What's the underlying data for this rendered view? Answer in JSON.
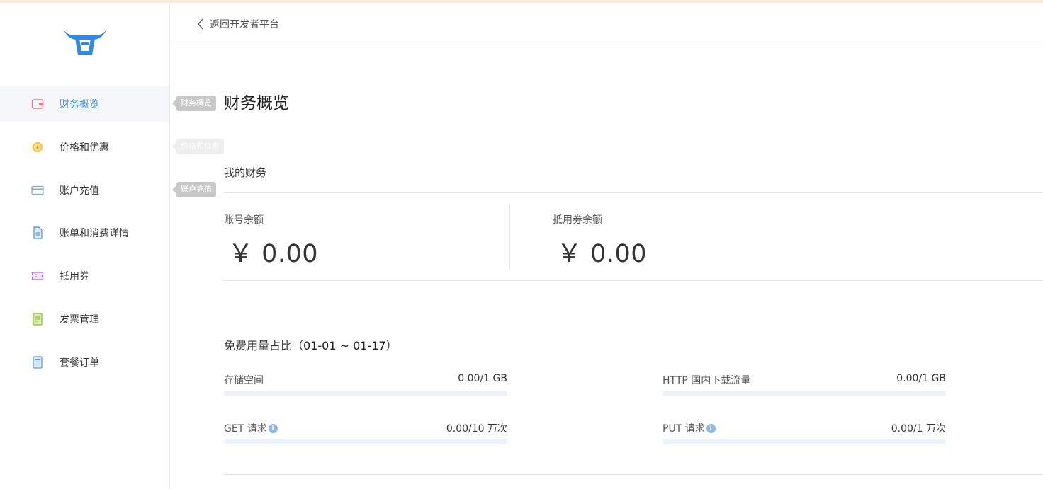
{
  "colors": {
    "accent": "#3a8ee6",
    "topbar": "#f7ecd5",
    "tooltip_gray": "#c8c8c8",
    "tooltip_faded": "#e6e6e6"
  },
  "header": {
    "back_label": "返回开发者平台"
  },
  "sidebar": {
    "items": [
      {
        "label": "财务概览",
        "icon": "wallet-icon",
        "active": true
      },
      {
        "label": "价格和优惠",
        "icon": "yuan-coin-icon"
      },
      {
        "label": "账户充值",
        "icon": "credit-card-icon"
      },
      {
        "label": "账单和消费详情",
        "icon": "bill-document-icon"
      },
      {
        "label": "抵用券",
        "icon": "coupon-ticket-icon"
      },
      {
        "label": "发票管理",
        "icon": "invoice-icon"
      },
      {
        "label": "套餐订单",
        "icon": "order-list-icon"
      }
    ],
    "tooltips": [
      "财务概览",
      "价格和优惠",
      "账户充值"
    ]
  },
  "main": {
    "title": "财务概览",
    "my_finance": {
      "title": "我的财务",
      "account_balance": {
        "label": "账号余额",
        "value": "￥ 0.00"
      },
      "coupon_balance": {
        "label": "抵用券余额",
        "value": "￥ 0.00"
      }
    },
    "usage": {
      "title": "免费用量占比（",
      "range": "01-01 ~ 01-17",
      "title_end": "）",
      "items": [
        {
          "label": "存储空间",
          "value": "0.00/1 GB",
          "fraction": 0,
          "info": false
        },
        {
          "label": "HTTP 国内下载流量",
          "value": "0.00/1 GB",
          "fraction": 0,
          "info": false
        },
        {
          "label": "GET 请求",
          "value": "0.00/10 万次",
          "fraction": 0,
          "info": true
        },
        {
          "label": "PUT 请求",
          "value": "0.00/1 万次",
          "fraction": 0,
          "info": true
        }
      ]
    }
  }
}
